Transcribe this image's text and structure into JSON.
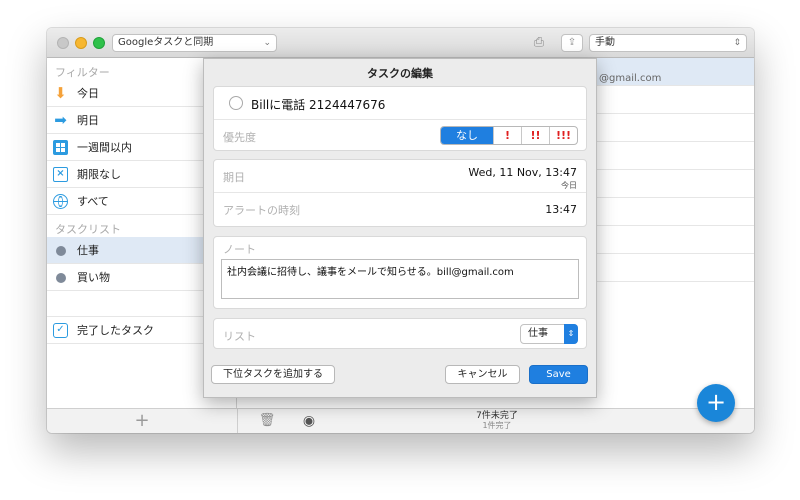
{
  "toolbar": {
    "sync_popup": "Googleタスクと同期",
    "sort_popup": "手動"
  },
  "sidebar": {
    "filter_header": "フィルター",
    "filters": [
      {
        "label": "今日",
        "icon": "arrow-down-icon"
      },
      {
        "label": "明日",
        "icon": "arrow-right-icon"
      },
      {
        "label": "一週間以内",
        "icon": "calendar-week-icon"
      },
      {
        "label": "期限なし",
        "icon": "calendar-nodate-icon"
      },
      {
        "label": "すべて",
        "icon": "globe-icon"
      }
    ],
    "lists_header": "タスクリスト",
    "lists": [
      {
        "label": "仕事",
        "selected": true,
        "icon": "dot-icon"
      },
      {
        "label": "買い物",
        "selected": false,
        "icon": "dot-icon"
      }
    ],
    "completed": {
      "label": "完了したタスク",
      "icon": "checkmark-icon"
    }
  },
  "main": {
    "first_row_partial_text": "@gmail.com"
  },
  "status": {
    "incomplete": "7件未完了",
    "complete": "1件完了"
  },
  "dialog": {
    "title": "タスクの編集",
    "task_title": "Billに電話 2124447676",
    "priority_label": "優先度",
    "priority_options": [
      "なし",
      "!",
      "!!",
      "!!!"
    ],
    "priority_selected": "なし",
    "due_label": "期日",
    "due_value": "Wed, 11 Nov, 13:47",
    "due_sub": "今日",
    "alarm_label": "アラートの時刻",
    "alarm_value": "13:47",
    "note_label": "ノート",
    "note_value": "社内会議に招待し、議事をメールで知らせる。bill@gmail.com",
    "list_label": "リスト",
    "list_value": "仕事",
    "add_subtask_label": "下位タスクを追加する",
    "cancel_label": "キャンセル",
    "save_label": "Save"
  },
  "colors": {
    "accent": "#1f7fe0",
    "fab": "#1a86d9",
    "priority_red": "#e02020",
    "selected_row": "#dfe9f5"
  }
}
